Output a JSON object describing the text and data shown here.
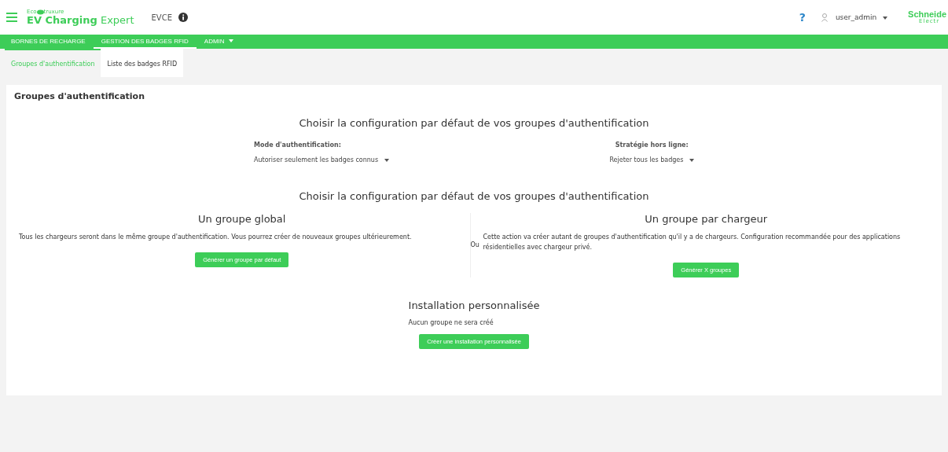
{
  "header": {
    "brand_prefix": "Eco",
    "brand_suffix": "truxure",
    "app_name_bold": "EV Charging",
    "app_name_light": "Expert",
    "site": "EVCE",
    "help": "?",
    "user": "user_admin",
    "vendor": "Schneide",
    "vendor_sub": "Electr"
  },
  "nav": [
    {
      "label": "BORNES DE RECHARGE",
      "selected": false,
      "dropdown": false
    },
    {
      "label": "GESTION DES BADGES RFID",
      "selected": true,
      "dropdown": false
    },
    {
      "label": "ADMIN",
      "selected": false,
      "dropdown": true
    }
  ],
  "subtabs": [
    {
      "label": "Groupes d'authentification",
      "selected": true
    },
    {
      "label": "Liste des badges RFID",
      "selected": false
    }
  ],
  "page_title": "Groupes d'authentification",
  "defaults": {
    "heading": "Choisir la configuration par défaut de vos groupes d'authentification",
    "fields": [
      {
        "label": "Mode d'authentification:",
        "value": "Autoriser seulement les badges connus"
      },
      {
        "label": "Stratégie hors ligne:",
        "value": "Rejeter tous les badges"
      }
    ]
  },
  "options": {
    "heading": "Choisir la configuration par défaut de vos groupes d'authentification",
    "separator": "Ou",
    "cards": [
      {
        "title": "Un groupe global",
        "text": "Tous les chargeurs seront dans le même groupe d'authentification. Vous pourrez créer de nouveaux groupes ultérieurement.",
        "button": "Générer un groupe par défaut"
      },
      {
        "title": "Un groupe par chargeur",
        "text": "Cette action va créer autant de groupes d'authentification qu'il y a de chargeurs. Configuration recommandée pour des applications résidentielles avec chargeur privé.",
        "button": "Générer X groupes"
      }
    ]
  },
  "custom": {
    "title": "Installation personnalisée",
    "text": "Aucun groupe ne sera créé",
    "button": "Créer une installation personnalisée"
  }
}
